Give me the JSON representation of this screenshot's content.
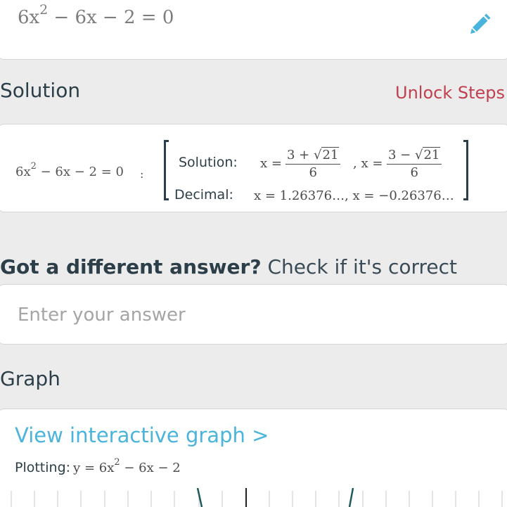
{
  "input": {
    "equation": {
      "coef": "6x",
      "exp": "2",
      "rest": " − 6x − 2 = 0"
    },
    "edit_icon": "pencil-icon"
  },
  "solution_section": {
    "title": "Solution",
    "unlock_label": "Unlock Steps"
  },
  "solution_card": {
    "equation": {
      "coef": "6x",
      "exp": "2",
      "rest": " − 6x − 2 = 0"
    },
    "colon": ":",
    "solution_label": "Solution:",
    "x_eq_1": "x =",
    "frac1_num_a": "3 + ",
    "frac1_radicand": "21",
    "frac1_den": "6",
    "sep": ", x =",
    "frac2_num_a": "3 − ",
    "frac2_radicand": "21",
    "frac2_den": "6",
    "decimal_label": "Decimal:",
    "decimal_values": "x = 1.26376…, x =  −0.26376…",
    "sqrt_symbol": "√"
  },
  "check_section": {
    "question_bold": "Got a different answer?",
    "question_rest": " Check if it's correct",
    "answer_placeholder": "Enter your answer"
  },
  "graph_section": {
    "title": "Graph",
    "link_label": "View interactive graph >",
    "plotting_label": "Plotting:",
    "plot_equation": {
      "lhs": "y = 6x",
      "exp": "2",
      "rest": " − 6x − 2"
    }
  },
  "colors": {
    "accent_link": "#4ab4dc",
    "unlock": "#c0404f",
    "text_dark": "#2c3e48",
    "background": "#ececec",
    "curve": "#1f5a5a"
  }
}
